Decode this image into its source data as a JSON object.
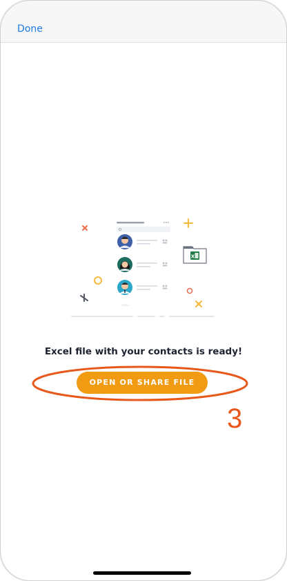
{
  "nav": {
    "done_label": "Done"
  },
  "main": {
    "message": "Excel file with your contacts is ready!",
    "button_label": "OPEN OR SHARE FILE",
    "illustration_badge": "X"
  },
  "annotation": {
    "step_number": "3"
  },
  "colors": {
    "accent_blue": "#1f7ae0",
    "button_orange": "#f19b12",
    "annotation_red": "#e8581a",
    "excel_green": "#1f7a45",
    "text_dark": "#1e2230"
  }
}
